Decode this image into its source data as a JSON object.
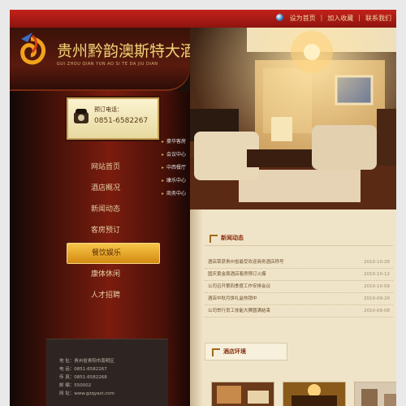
{
  "topbar": {
    "links": [
      "设为首页",
      "加入收藏",
      "联系我们"
    ]
  },
  "header": {
    "hotel_name": "贵州黔韵澳斯特大酒店",
    "hotel_sub": "GUI ZHOU QIAN YUN AO SI TE DA JIU DIAN"
  },
  "phone": {
    "label": "预订电话：",
    "number": "0851-6582267"
  },
  "nav": {
    "items": [
      {
        "label": "网站首页"
      },
      {
        "label": "酒店概况"
      },
      {
        "label": "新闻动态"
      },
      {
        "label": "客房预订"
      },
      {
        "label": "餐饮娱乐"
      },
      {
        "label": "康体休闲"
      },
      {
        "label": "人才招聘"
      }
    ],
    "active_index": 4
  },
  "submenu": {
    "items": [
      "豪华客房",
      "会议中心",
      "中西餐厅",
      "康乐中心",
      "商务中心"
    ]
  },
  "contact": {
    "lines": [
      "地 址：贵州省贵阳市南明区",
      "电 话：0851-6582267",
      "传 真：0851-6582268",
      "邮 编：550002",
      "网 址：www.gzqyast.com"
    ]
  },
  "news": {
    "title": "新闻动态",
    "items": [
      {
        "title": "酒店荣获贵州省最受欢迎商务酒店称号",
        "date": "2010-10-26"
      },
      {
        "title": "国庆黄金周酒店客房预订火爆",
        "date": "2010-10-12"
      },
      {
        "title": "公司召开第四季度工作安排会议",
        "date": "2010-10-09"
      },
      {
        "title": "酒店中秋月饼礼盒热销中",
        "date": "2010-09-20"
      },
      {
        "title": "公司举行员工技能大赛圆满结束",
        "date": "2010-09-08"
      }
    ]
  },
  "rooms": {
    "title": "酒店环境"
  },
  "colors": {
    "topbar": "#c3221a",
    "gold": "#f1d07a",
    "content_bg": "#f0e4c8",
    "accent": "#8a2d0f"
  }
}
